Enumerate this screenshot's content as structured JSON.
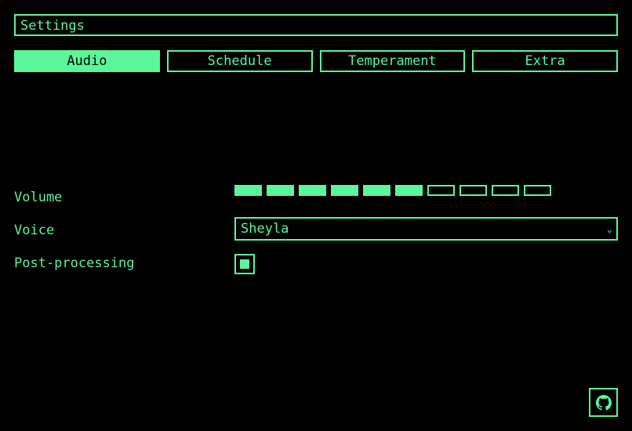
{
  "header": {
    "title": "Settings"
  },
  "tabs": [
    {
      "label": "Audio",
      "active": true
    },
    {
      "label": "Schedule",
      "active": false
    },
    {
      "label": "Temperament",
      "active": false
    },
    {
      "label": "Extra",
      "active": false
    }
  ],
  "settings": {
    "volume": {
      "label": "Volume",
      "level": 6,
      "max": 10
    },
    "voice": {
      "label": "Voice",
      "selected": "Sheyla"
    },
    "post_processing": {
      "label": "Post-processing",
      "checked": true
    }
  },
  "footer": {
    "icon": "github-icon"
  },
  "colors": {
    "accent": "#5cf59a",
    "background": "#000000"
  }
}
